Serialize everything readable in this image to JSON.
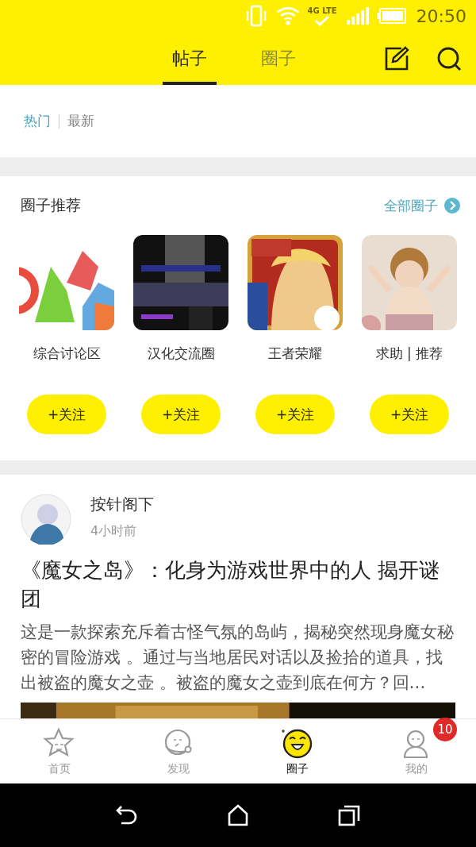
{
  "status_bar": {
    "network": "4G LTE",
    "time": "20:50"
  },
  "header": {
    "tabs": [
      {
        "label": "帖子",
        "selected": true
      },
      {
        "label": "圈子",
        "selected": false
      }
    ]
  },
  "filters": [
    {
      "label": "热门",
      "selected": true
    },
    {
      "label": "最新",
      "selected": false
    }
  ],
  "circles": {
    "title": "圈子推荐",
    "more": "全部圈子",
    "items": [
      {
        "name": "综合讨论区",
        "follow": "+关注"
      },
      {
        "name": "汉化交流圈",
        "follow": "+关注"
      },
      {
        "name": "王者荣耀",
        "follow": "+关注"
      },
      {
        "name": "求助 | 推荐",
        "follow": "+关注"
      }
    ]
  },
  "post": {
    "author": "按针阁下",
    "time": "4小时前",
    "title": "《魔女之岛》：化身为游戏世界中的人 揭开谜团",
    "excerpt": "这是一款探索充斥着古怪气氛的岛屿，揭秘突然现身魔女秘密的冒险游戏 。通过与当地居民对话以及捡拾的道具，找出被盗的魔女之壶 。被盗的魔女之壶到底在何方？回…"
  },
  "bottom_nav": [
    {
      "label": "首页",
      "selected": false
    },
    {
      "label": "发现",
      "selected": false
    },
    {
      "label": "圈子",
      "selected": true
    },
    {
      "label": "我的",
      "selected": false,
      "badge": "10"
    }
  ]
}
